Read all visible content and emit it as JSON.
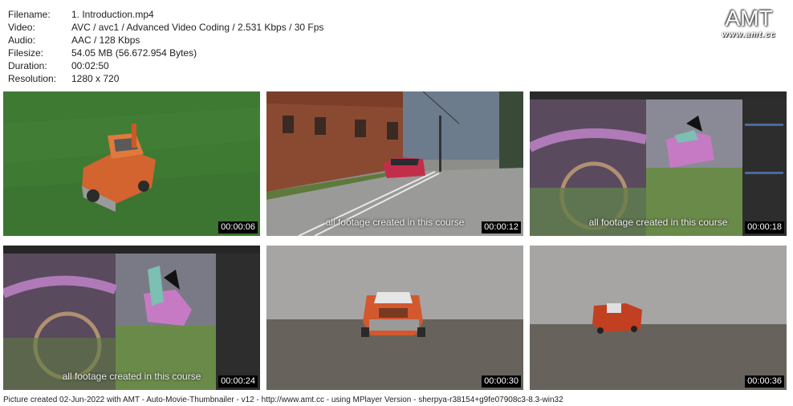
{
  "info": {
    "rows": [
      {
        "key": "Filename:",
        "value": "1. Introduction.mp4"
      },
      {
        "key": "Video:",
        "value": "AVC / avc1 / Advanced Video Coding / 2.531 Kbps / 30 Fps"
      },
      {
        "key": "Audio:",
        "value": "AAC / 128 Kbps"
      },
      {
        "key": "Filesize:",
        "value": "54.05 MB (56.672.954 Bytes)"
      },
      {
        "key": "Duration:",
        "value": "00:02:50"
      },
      {
        "key": "Resolution:",
        "value": "1280 x 720"
      }
    ]
  },
  "logo": {
    "main": "AMT",
    "sub": "www.amt.cc"
  },
  "thumbnails": [
    {
      "time": "00:00:06",
      "caption": ""
    },
    {
      "time": "00:00:12",
      "caption": "all footage created in this course"
    },
    {
      "time": "00:00:18",
      "caption": "all footage created in this course"
    },
    {
      "time": "00:00:24",
      "caption": "all footage created in this course"
    },
    {
      "time": "00:00:30",
      "caption": ""
    },
    {
      "time": "00:00:36",
      "caption": ""
    }
  ],
  "footer": "Picture created 02-Jun-2022 with AMT - Auto-Movie-Thumbnailer - v12 - http://www.amt.cc - using MPlayer Version - sherpya-r38154+g9fe07908c3-8.3-win32"
}
